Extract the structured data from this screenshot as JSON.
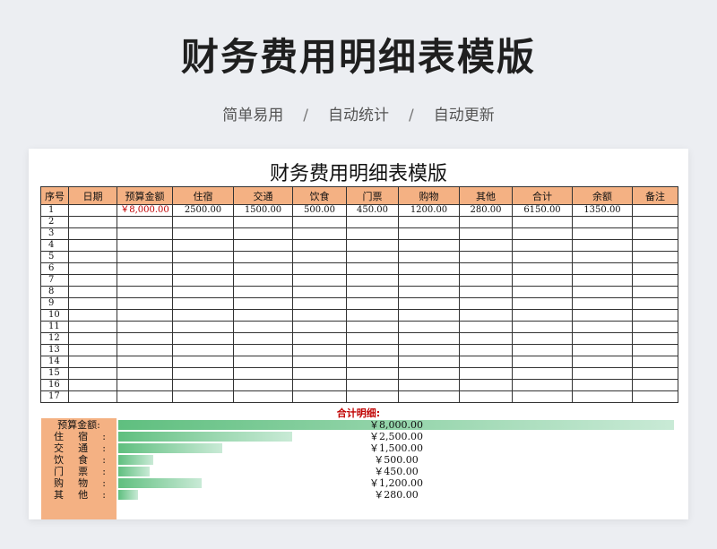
{
  "hero": {
    "title": "财务费用明细表模版",
    "tags": [
      "简单易用",
      "自动统计",
      "自动更新"
    ],
    "separator": "/"
  },
  "sheet": {
    "title": "财务费用明细表模版",
    "headers": [
      "序号",
      "日期",
      "预算金额",
      "住宿",
      "交通",
      "饮食",
      "门票",
      "购物",
      "其他",
      "合计",
      "余额",
      "备注"
    ],
    "rows": [
      [
        "1",
        "",
        "￥8,000.00",
        "2500.00",
        "1500.00",
        "500.00",
        "450.00",
        "1200.00",
        "280.00",
        "6150.00",
        "1350.00",
        ""
      ],
      [
        "2",
        "",
        "",
        "",
        "",
        "",
        "",
        "",
        "",
        "",
        "",
        ""
      ],
      [
        "3",
        "",
        "",
        "",
        "",
        "",
        "",
        "",
        "",
        "",
        "",
        ""
      ],
      [
        "4",
        "",
        "",
        "",
        "",
        "",
        "",
        "",
        "",
        "",
        "",
        ""
      ],
      [
        "5",
        "",
        "",
        "",
        "",
        "",
        "",
        "",
        "",
        "",
        "",
        ""
      ],
      [
        "6",
        "",
        "",
        "",
        "",
        "",
        "",
        "",
        "",
        "",
        "",
        ""
      ],
      [
        "7",
        "",
        "",
        "",
        "",
        "",
        "",
        "",
        "",
        "",
        "",
        ""
      ],
      [
        "8",
        "",
        "",
        "",
        "",
        "",
        "",
        "",
        "",
        "",
        "",
        ""
      ],
      [
        "9",
        "",
        "",
        "",
        "",
        "",
        "",
        "",
        "",
        "",
        "",
        ""
      ],
      [
        "10",
        "",
        "",
        "",
        "",
        "",
        "",
        "",
        "",
        "",
        "",
        ""
      ],
      [
        "11",
        "",
        "",
        "",
        "",
        "",
        "",
        "",
        "",
        "",
        "",
        ""
      ],
      [
        "12",
        "",
        "",
        "",
        "",
        "",
        "",
        "",
        "",
        "",
        "",
        ""
      ],
      [
        "13",
        "",
        "",
        "",
        "",
        "",
        "",
        "",
        "",
        "",
        "",
        ""
      ],
      [
        "14",
        "",
        "",
        "",
        "",
        "",
        "",
        "",
        "",
        "",
        "",
        ""
      ],
      [
        "15",
        "",
        "",
        "",
        "",
        "",
        "",
        "",
        "",
        "",
        "",
        ""
      ],
      [
        "16",
        "",
        "",
        "",
        "",
        "",
        "",
        "",
        "",
        "",
        "",
        ""
      ],
      [
        "17",
        "",
        "",
        "",
        "",
        "",
        "",
        "",
        "",
        "",
        "",
        ""
      ]
    ],
    "budget_color": "#c00000"
  },
  "summary": {
    "title": "合计明细:",
    "items": [
      {
        "label": "预算金额:",
        "value": "￥8,000.00",
        "fraction": 1.0
      },
      {
        "label": "住　宿:",
        "value": "￥2,500.00",
        "fraction": 0.3125
      },
      {
        "label": "交　通:",
        "value": "￥1,500.00",
        "fraction": 0.1875
      },
      {
        "label": "饮　食:",
        "value": "￥500.00",
        "fraction": 0.0625
      },
      {
        "label": "门　票:",
        "value": "￥450.00",
        "fraction": 0.05625
      },
      {
        "label": "购　物:",
        "value": "￥1,200.00",
        "fraction": 0.15
      },
      {
        "label": "其　他:",
        "value": "￥280.00",
        "fraction": 0.035
      }
    ]
  },
  "colors": {
    "header_fill": "#f4b183",
    "bar_start": "#5fbf7f",
    "bar_end": "#c9ead6",
    "summary_title": "#c00000"
  }
}
